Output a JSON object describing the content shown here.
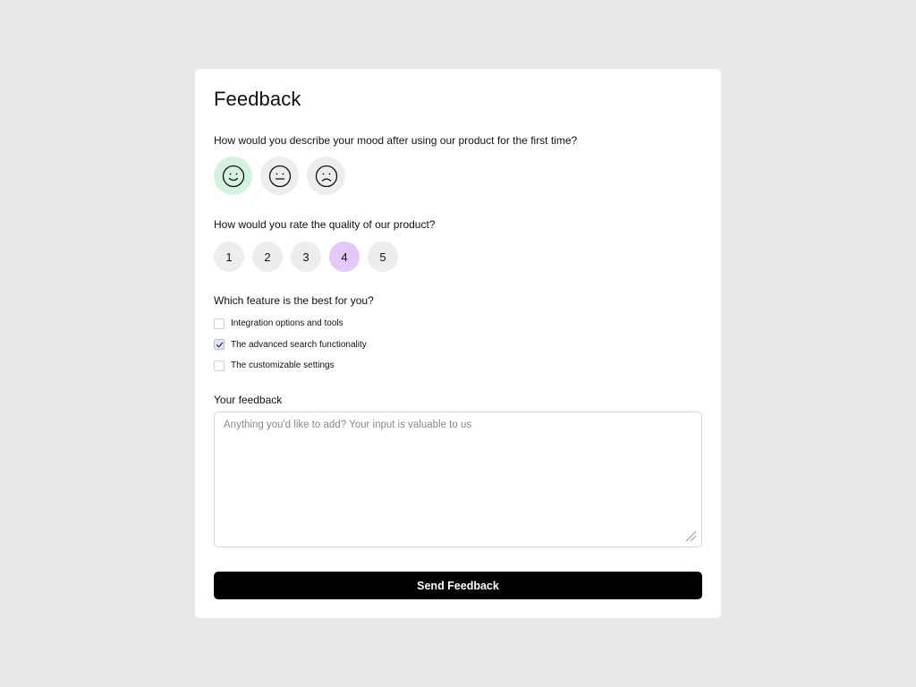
{
  "form": {
    "title": "Feedback",
    "mood": {
      "question": "How would you describe your mood after using our product for the first time?",
      "options": [
        {
          "icon": "smile-face-icon",
          "selected": true,
          "selected_color": "#d4f3dc"
        },
        {
          "icon": "neutral-face-icon",
          "selected": false
        },
        {
          "icon": "sad-face-icon",
          "selected": false
        }
      ]
    },
    "rating": {
      "question": "How would you rate the quality of our product?",
      "options": [
        "1",
        "2",
        "3",
        "4",
        "5"
      ],
      "selected": "4",
      "selected_color": "#e3c9f9"
    },
    "features": {
      "question": "Which feature is the best for you?",
      "options": [
        {
          "label": "Integration options and tools",
          "checked": false
        },
        {
          "label": "The advanced search functionality",
          "checked": true
        },
        {
          "label": "The customizable settings",
          "checked": false
        }
      ]
    },
    "feedback": {
      "label": "Your feedback",
      "value": "",
      "placeholder": "Anything you'd like to add? Your input is valuable to us"
    },
    "submit_label": "Send Feedback"
  },
  "colors": {
    "background": "#e8e8e8",
    "card": "#ffffff",
    "button": "#000000",
    "option_default": "#ededed"
  }
}
